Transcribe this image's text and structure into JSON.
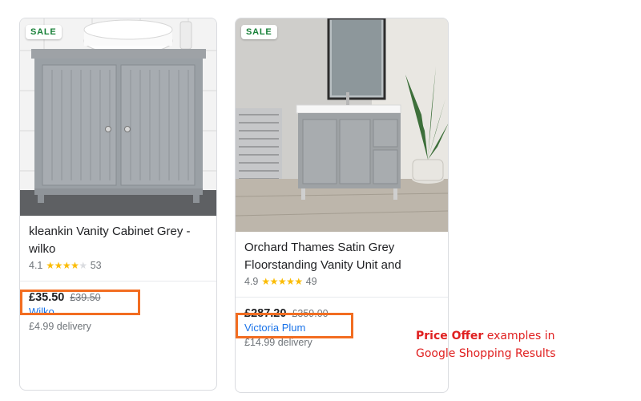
{
  "products": [
    {
      "badge": "SALE",
      "title": "kleankin Vanity Cabinet Grey - wilko",
      "rating": "4.1",
      "stars_filled": 4,
      "stars_total": 5,
      "reviews": "53",
      "price": "£35.50",
      "old_price": "£39.50",
      "seller": "Wilko",
      "delivery": "£4.99 delivery",
      "image": "grey-under-sink-vanity-cabinet"
    },
    {
      "badge": "SALE",
      "title": "Orchard Thames Satin Grey Floorstanding Vanity Unit and",
      "rating": "4.9",
      "stars_filled": 5,
      "stars_total": 5,
      "reviews": "49",
      "price": "£287.20",
      "old_price": "£359.00",
      "seller": "Victoria Plum",
      "delivery": "£14.99 delivery",
      "image": "grey-floorstanding-vanity-unit-bathroom"
    }
  ],
  "annotation": {
    "bold": "Price Offer",
    "line1_rest": " examples in",
    "line2": "Google Shopping Results"
  },
  "colors": {
    "highlight": "#f26d21",
    "annotation": "#e02020",
    "sale_badge": "#188038",
    "stars": "#fbbc04",
    "seller_link": "#1a73e8"
  }
}
